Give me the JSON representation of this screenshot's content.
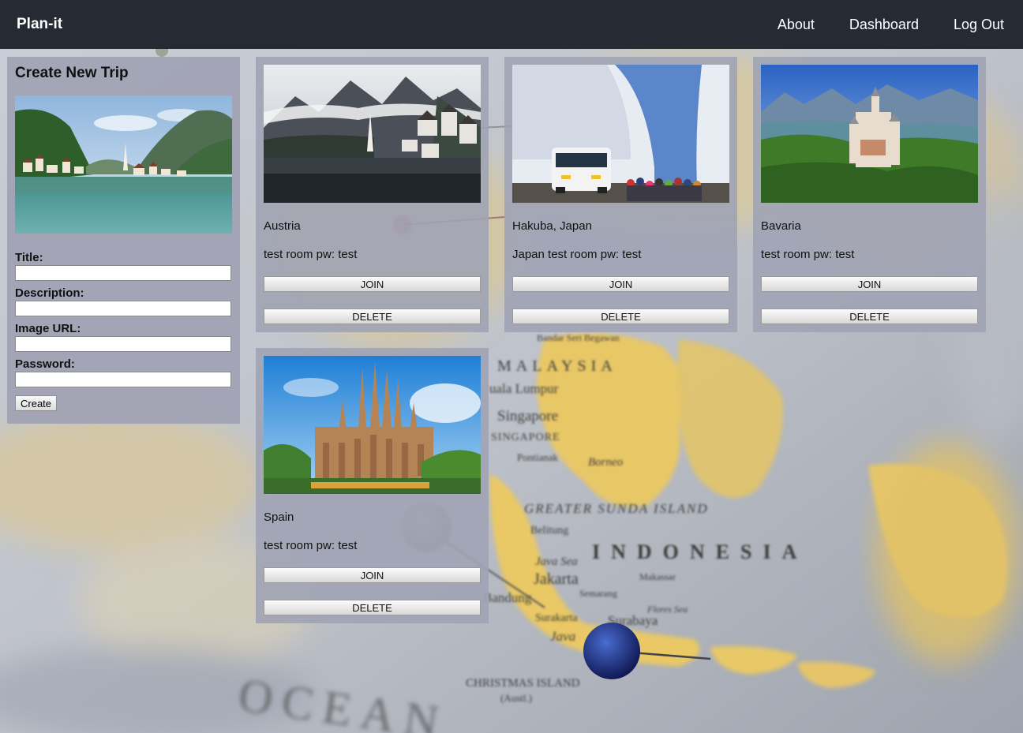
{
  "navbar": {
    "brand": "Plan-it",
    "links": [
      "About",
      "Dashboard",
      "Log Out"
    ]
  },
  "create_panel": {
    "title": "Create New Trip",
    "fields": {
      "title_label": "Title:",
      "description_label": "Description:",
      "image_url_label": "Image URL:",
      "password_label": "Password:"
    },
    "values": {
      "title": "",
      "description": "",
      "image_url": "",
      "password": ""
    },
    "create_label": "Create"
  },
  "trips": [
    {
      "title": "Austria",
      "description": "test room pw: test",
      "join_label": "JOIN",
      "delete_label": "DELETE",
      "image": "hallstatt-lake-village-photo"
    },
    {
      "title": "Hakuba, Japan",
      "description": "Japan test room pw: test",
      "join_label": "JOIN",
      "delete_label": "DELETE",
      "image": "snow-wall-bus-photo"
    },
    {
      "title": "Bavaria",
      "description": "test room pw: test",
      "join_label": "JOIN",
      "delete_label": "DELETE",
      "image": "castle-mountains-photo"
    },
    {
      "title": "Spain",
      "description": "test room pw: test",
      "join_label": "JOIN",
      "delete_label": "DELETE",
      "image": "sagrada-familia-photo"
    }
  ],
  "background_map_labels": {
    "malaysia": "MALAYSIA",
    "kuala_lumpur": "uala Lumpur",
    "singapore": "Singapore",
    "singapore_caps": "SINGAPORE",
    "pontianak": "Pontianak",
    "borneo": "Borneo",
    "greater_sunda": "GREATER SUNDA ISLAND",
    "belitung": "Belitung",
    "java_sea": "Java Sea",
    "jakarta": "Jakarta",
    "bandung": "Bandung",
    "semarang": "Semarang",
    "surakarta": "Surakarta",
    "surabaya": "Surabaya",
    "java": "Java",
    "indonesia": "INDONESIA",
    "christmas_island": "CHRISTMAS ISLAND",
    "austl": "(Austl.)",
    "ocean": "OCEAN",
    "bandar_seri_begawan": "Bandar Seri Begawan",
    "makassar": "Makassar",
    "flores_sea": "Flores Sea"
  },
  "colors": {
    "navbar": "#262a33",
    "panel": "#a0a3b4",
    "land": "#e9c865",
    "sea": "#cfd3db"
  }
}
